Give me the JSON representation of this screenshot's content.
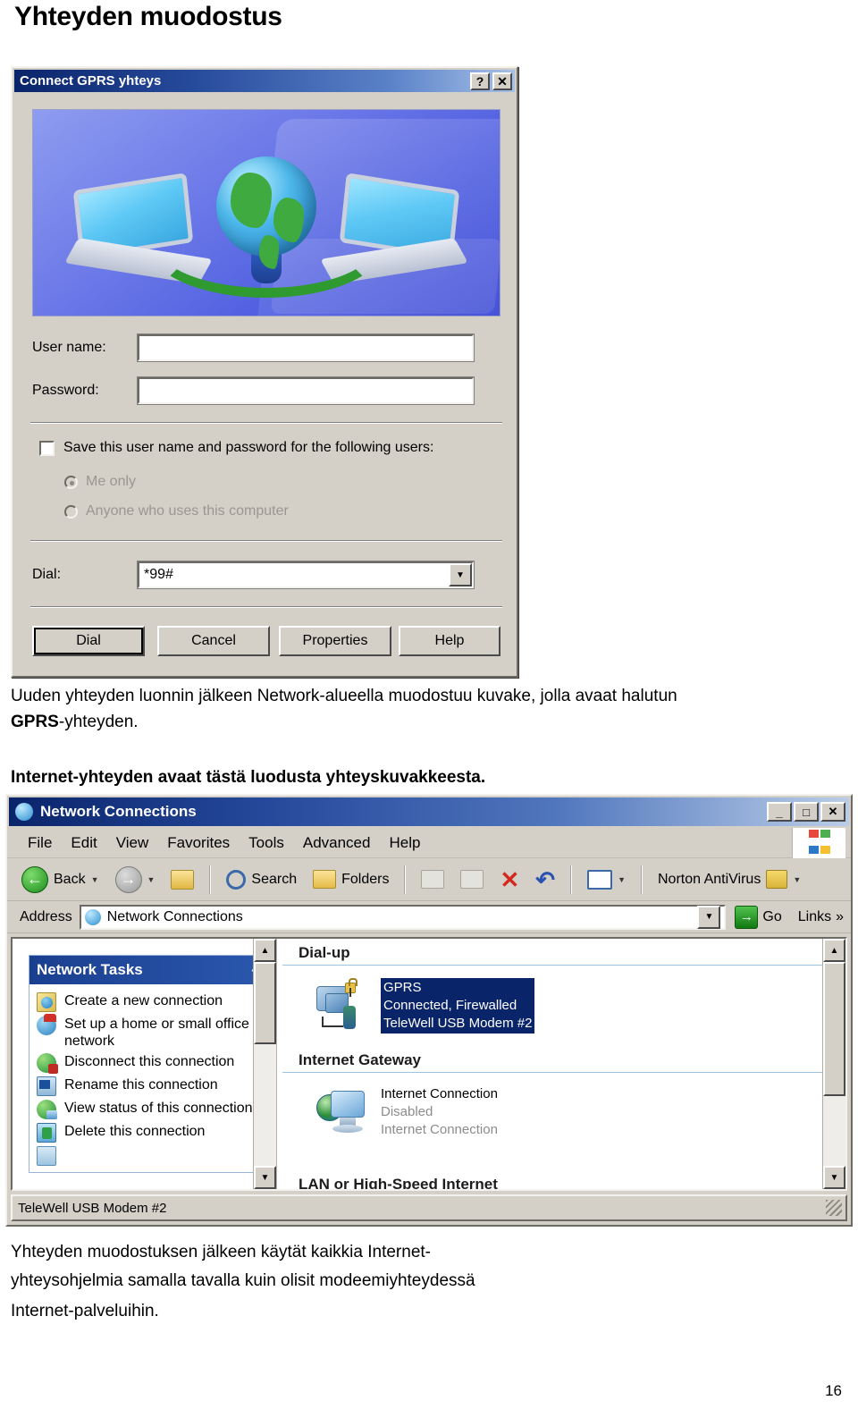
{
  "document": {
    "title": "Yhteyden muodostus",
    "paragraph1": "Uuden yhteyden luonnin jälkeen Network-alueella muodostuu kuvake, jolla avaat halutun",
    "paragraph1_bold": "GPRS",
    "paragraph1_tail": "yhteyden.",
    "paragraph2": "Internet-yhteyden avaat tästä luodusta yhteyskuvakkeesta.",
    "paragraph3_line1": "Yhteyden muodostuksen jälkeen käytät kaikkia Internet-",
    "paragraph3_line2": "yhteysohjelmia samalla tavalla kuin olisit modeemiyhteydessä",
    "paragraph3_line3": "Internet-palveluihin.",
    "page_number": "16"
  },
  "connect_dialog": {
    "title": "Connect GPRS yhteys",
    "help_button": "?",
    "close_button": "✕",
    "banner_alt": "two-laptops-globe-graphic",
    "fields": [
      {
        "label": "User name:",
        "value": "",
        "accel": "U"
      },
      {
        "label": "Password:",
        "value": "",
        "accel": "P"
      }
    ],
    "save_checkbox": {
      "label": "Save this user name and password for the following users:",
      "checked": false
    },
    "radios": [
      {
        "label": "Me only",
        "selected": true,
        "disabled": true
      },
      {
        "label": "Anyone who uses this computer",
        "selected": false,
        "disabled": true
      }
    ],
    "dial": {
      "label": "Dial:",
      "value": "*99#"
    },
    "buttons": [
      "Dial",
      "Cancel",
      "Properties",
      "Help"
    ]
  },
  "network_window": {
    "title": "Network Connections",
    "window_controls": {
      "minimize": "_",
      "maximize": "□",
      "close": "✕"
    },
    "menu": [
      "File",
      "Edit",
      "View",
      "Favorites",
      "Tools",
      "Advanced",
      "Help"
    ],
    "toolbar": {
      "back": "Back",
      "search": "Search",
      "folders": "Folders",
      "norton": "Norton AntiVirus"
    },
    "address": {
      "label": "Address",
      "value": "Network Connections",
      "go": "Go",
      "links": "Links",
      "links_overflow": "»"
    },
    "sidebar": {
      "panel_title": "Network Tasks",
      "tasks": [
        {
          "label": "Create a new connection",
          "icon": "new-connection-icon"
        },
        {
          "label": "Set up a home or small office network",
          "icon": "home-network-icon"
        },
        {
          "label": "Disconnect this connection",
          "icon": "disconnect-icon"
        },
        {
          "label": "Rename this connection",
          "icon": "rename-icon"
        },
        {
          "label": "View status of this connection",
          "icon": "view-status-icon"
        },
        {
          "label": "Delete this connection",
          "icon": "delete-icon"
        }
      ]
    },
    "content": {
      "groups": [
        {
          "header": "Dial-up",
          "items": [
            {
              "name": "GPRS",
              "status": "Connected, Firewalled",
              "device": "TeleWell USB Modem #2",
              "selected": true
            }
          ]
        },
        {
          "header": "Internet Gateway",
          "items": [
            {
              "name": "Internet Connection",
              "status": "Disabled",
              "device": "Internet Connection",
              "selected": false
            }
          ]
        },
        {
          "header": "LAN or High-Speed Internet",
          "items": []
        }
      ]
    },
    "statusbar": "TeleWell USB Modem #2"
  },
  "colors": {
    "titlebar_blue": "#0a246a",
    "selection_blue": "#0a246a",
    "dialog_face": "#d4d0c8",
    "panel_header": "#1b3f8f"
  }
}
